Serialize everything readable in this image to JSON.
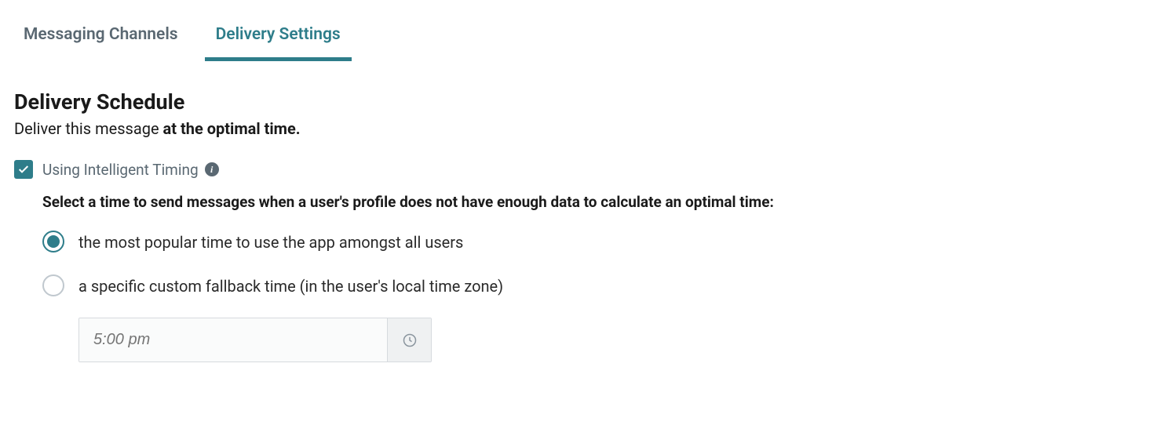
{
  "tabs": {
    "messaging": "Messaging Channels",
    "delivery": "Delivery Settings"
  },
  "section": {
    "title": "Delivery Schedule",
    "sub_prefix": "Deliver this message ",
    "sub_bold": "at the optimal time."
  },
  "intelligent_timing": {
    "label": "Using Intelligent Timing",
    "checked": true,
    "fallback_prompt": "Select a time to send messages when a user's profile does not have enough data to calculate an optimal time:"
  },
  "fallback_options": {
    "popular": "the most popular time to use the app amongst all users",
    "custom": "a specific custom fallback time (in the user's local time zone)",
    "selected": "popular"
  },
  "time_input": {
    "placeholder": "5:00 pm"
  }
}
